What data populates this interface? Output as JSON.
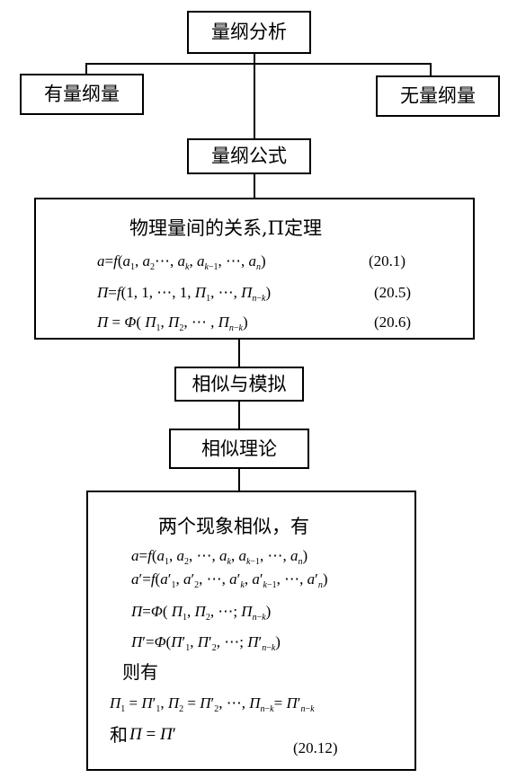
{
  "nodes": {
    "dim_analysis": "量纲分析",
    "dimensional": "有量纲量",
    "dimensionless": "无量纲量",
    "dim_formula": "量纲公式",
    "similarity_modeling": "相似与模拟",
    "similarity_theory": "相似理论"
  },
  "pi_box": {
    "heading": "物理量间的关系,Π定理",
    "eq1_num": "(20.1)",
    "eq2_num": "(20.5)",
    "eq3_num": "(20.6)"
  },
  "sim_box": {
    "heading": "两个现象相似，有",
    "then_label": "则有",
    "and_label": "和",
    "eq_num": "(20.12)"
  }
}
